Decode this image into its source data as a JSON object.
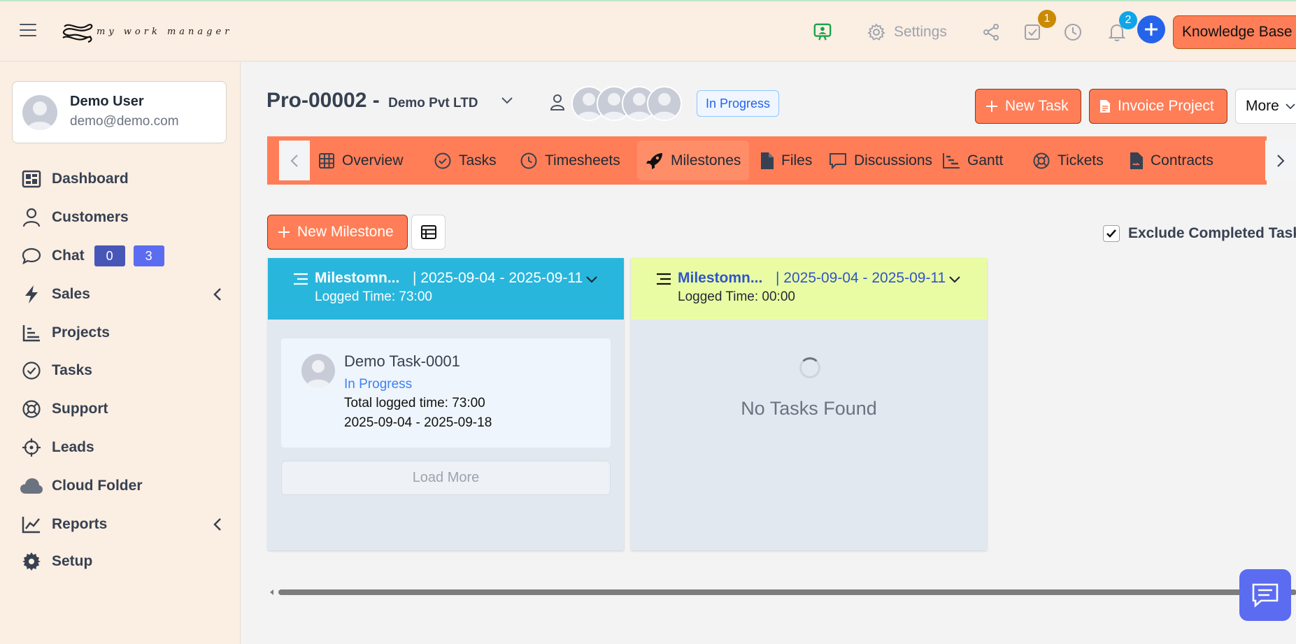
{
  "topbar": {
    "logo_text": "my work manager",
    "settings_label": "Settings",
    "tasks_badge": "1",
    "notifications_badge": "2",
    "knowledge_base_label": "Knowledge Base",
    "colors": {
      "bg": "#fbeee2",
      "accent": "#ff7e57",
      "primary": "#2563eb"
    }
  },
  "user": {
    "name": "Demo User",
    "email": "demo@demo.com"
  },
  "sidebar": {
    "items": [
      {
        "label": "Dashboard",
        "icon": "dashboard-icon"
      },
      {
        "label": "Customers",
        "icon": "user-icon"
      },
      {
        "label": "Chat",
        "icon": "chat-bubble-icon"
      },
      {
        "label": "Sales",
        "icon": "bolt-icon"
      },
      {
        "label": "Projects",
        "icon": "bar-chart-icon"
      },
      {
        "label": "Tasks",
        "icon": "check-circle-icon"
      },
      {
        "label": "Support",
        "icon": "life-ring-icon"
      },
      {
        "label": "Leads",
        "icon": "crosshair-icon"
      },
      {
        "label": "Cloud Folder",
        "icon": "cloud-icon"
      },
      {
        "label": "Reports",
        "icon": "line-chart-icon"
      },
      {
        "label": "Setup",
        "icon": "gear-icon"
      }
    ],
    "chat_badges": [
      "0",
      "3"
    ]
  },
  "project": {
    "code": "Pro-00002 -",
    "company": "Demo Pvt LTD",
    "status": "In Progress",
    "new_task_label": "New Task",
    "invoice_label": "Invoice Project",
    "more_label": "More"
  },
  "tabs": [
    {
      "label": "Overview",
      "icon": "grid-icon"
    },
    {
      "label": "Tasks",
      "icon": "check-circle-icon"
    },
    {
      "label": "Timesheets",
      "icon": "clock-icon"
    },
    {
      "label": "Milestones",
      "icon": "rocket-icon",
      "active": true
    },
    {
      "label": "Files",
      "icon": "file-icon"
    },
    {
      "label": "Discussions",
      "icon": "comment-icon"
    },
    {
      "label": "Gantt",
      "icon": "gantt-icon"
    },
    {
      "label": "Tickets",
      "icon": "life-ring-icon"
    },
    {
      "label": "Contracts",
      "icon": "contract-icon"
    }
  ],
  "milestones": {
    "new_label": "New Milestone",
    "exclude_label": "Exclude Completed Tasks",
    "exclude_checked": true,
    "columns": [
      {
        "title": "Milestomn...",
        "range": "| 2025-09-04 - 2025-09-11",
        "logged": "Logged Time: 73:00",
        "color": "#29b6dc",
        "tasks": [
          {
            "name": "Demo Task-0001",
            "status": "In Progress",
            "logged": "Total logged time: 73:00",
            "dates": "2025-09-04 - 2025-09-18"
          }
        ],
        "load_more": "Load More"
      },
      {
        "title": "Milestomn...",
        "range": "| 2025-09-04 - 2025-09-11",
        "logged": "Logged Time: 00:00",
        "color": "#eafca3",
        "empty_text": "No Tasks Found"
      }
    ]
  }
}
